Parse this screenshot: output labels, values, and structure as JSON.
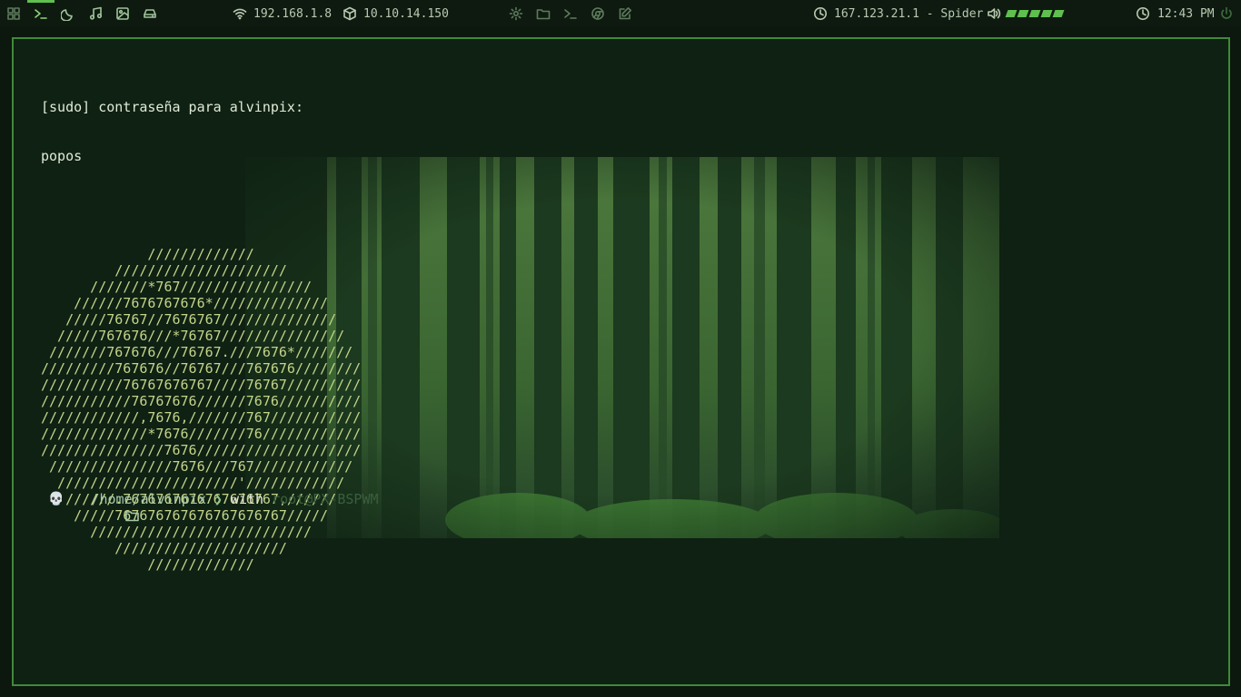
{
  "topbar": {
    "workspaces": [
      "grid-icon",
      "terminal-icon",
      "moon-icon",
      "music-icon",
      "image-icon",
      "drive-icon"
    ],
    "ip_local": "192.168.1.8",
    "ip_vpn": "10.10.14.150",
    "launchers": [
      "gear-icon",
      "folder-icon",
      "terminal-icon",
      "browser-icon",
      "edit-icon"
    ],
    "target": "167.123.21.1 - Spider",
    "volume_level": 1.0,
    "clock": "12:43 PM"
  },
  "terminal": {
    "sudo_prompt": "[sudo] contraseña para alvinpix:",
    "typed": "popos",
    "ascii_logo": [
      "             /////////////",
      "         /////////////////////",
      "      ///////*767////////////////",
      "    //////7676767676*//////////////",
      "   /////76767//7676767//////////////",
      "  /////767676///*76767///////////////",
      " ///////767676///76767.///7676*///////",
      "/////////767676//76767///767676////////",
      "//////////76767676767////76767/////////",
      "///////////76767676//////7676//////////",
      "////////////,7676,///////767///////////",
      "/////////////*7676///////76////////////",
      "///////////////7676////////////////////",
      " ///////////////7676///767////////////",
      "  //////////////////////'////////////",
      "   //////.7676767676767676767,//////",
      "    /////767676767676767676767/////",
      "      ///////////////////////////",
      "         /////////////////////",
      "             /////////////"
    ],
    "prompt": {
      "skull": "💀",
      "path": "/home/alvinpix",
      "chevron": "❯",
      "with": "with",
      "host": "root@PX-BSPWM"
    }
  },
  "colors": {
    "accent": "#5fbf4f",
    "border": "#3f8a39",
    "background": "#0c170e"
  }
}
